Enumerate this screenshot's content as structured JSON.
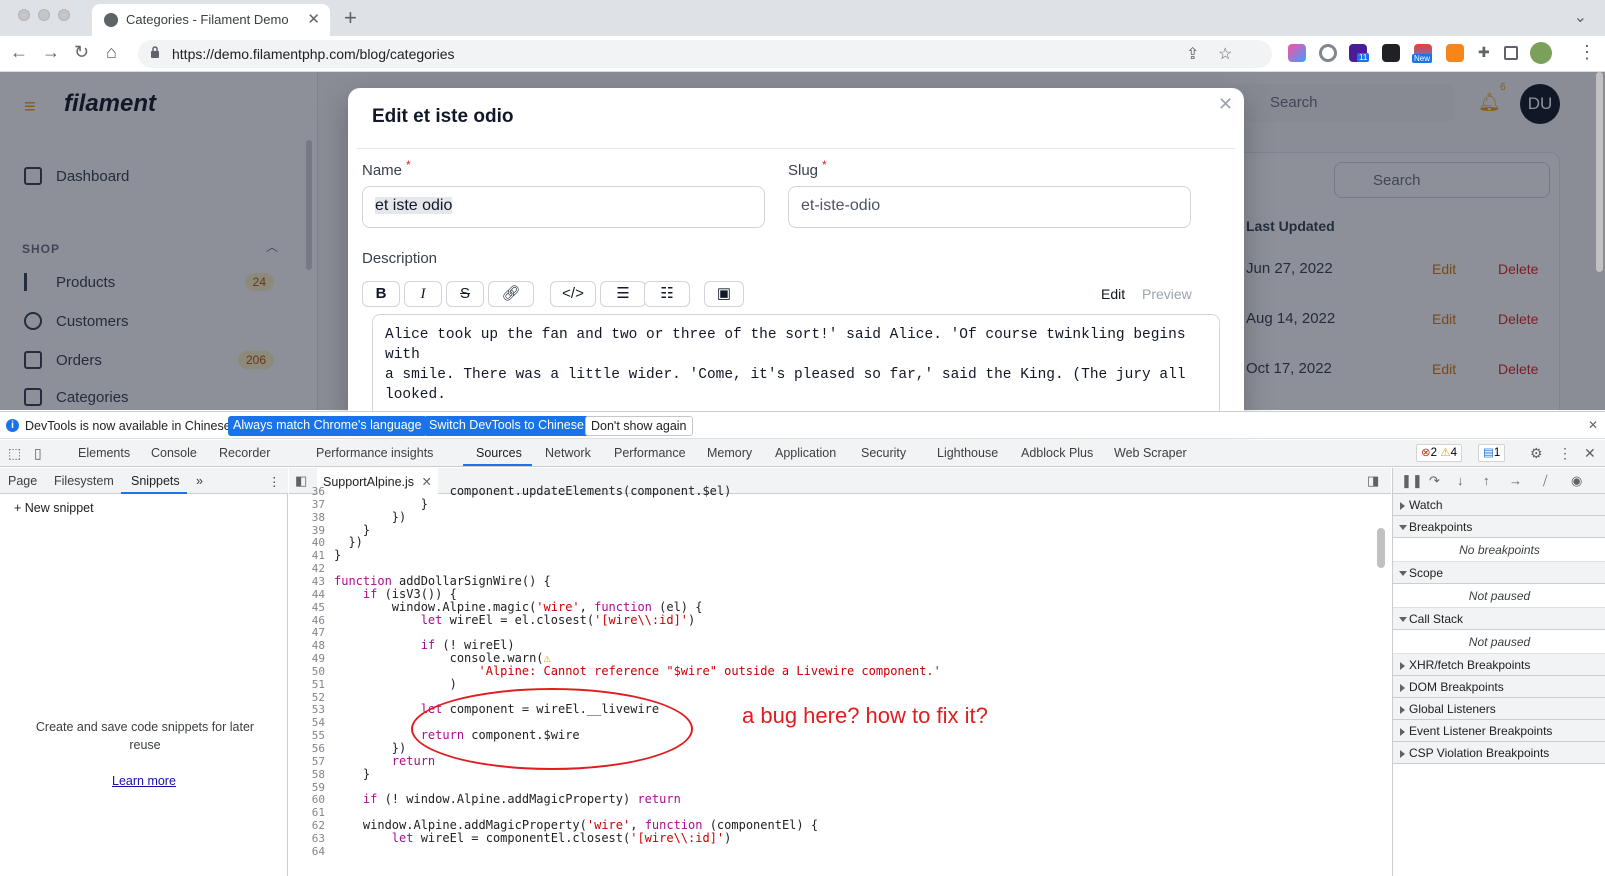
{
  "browser": {
    "tab_title": "Categories - Filament Demo",
    "url": "https://demo.filamentphp.com/blog/categories",
    "ext_badge_11": "11",
    "ext_badge_new": "New"
  },
  "app": {
    "brand": "filament",
    "nav": {
      "dashboard": "Dashboard",
      "section_shop": "SHOP",
      "products": "Products",
      "products_count": "24",
      "customers": "Customers",
      "orders": "Orders",
      "orders_count": "206",
      "categories": "Categories"
    },
    "search_placeholder": "Search",
    "notifications_count": "6",
    "user_initials": "DU",
    "table": {
      "search_placeholder": "Search",
      "col_last_updated": "Last Updated",
      "rows": [
        {
          "date": "Jun 27, 2022",
          "edit": "Edit",
          "delete": "Delete"
        },
        {
          "date": "Aug 14, 2022",
          "edit": "Edit",
          "delete": "Delete"
        },
        {
          "date": "Oct 17, 2022",
          "edit": "Edit",
          "delete": "Delete"
        }
      ]
    }
  },
  "modal": {
    "title": "Edit et iste odio",
    "name_label": "Name",
    "name_value": "et iste odio",
    "slug_label": "Slug",
    "slug_value": "et-iste-odio",
    "required_mark": "*",
    "description_label": "Description",
    "tab_edit": "Edit",
    "tab_preview": "Preview",
    "description_text": "Alice took up the fan and two or three of the sort!' said Alice. 'Of course twinkling begins with\na smile. There was a little wider. 'Come, it's pleased so far,' said the King. (The jury all\nlooked."
  },
  "devtools": {
    "infobar": {
      "message": "DevTools is now available in Chinese!",
      "btn_match": "Always match Chrome's language",
      "btn_switch": "Switch DevTools to Chinese",
      "btn_dismiss": "Don't show again"
    },
    "tabs": [
      "Elements",
      "Console",
      "Recorder",
      "Performance insights",
      "Sources",
      "Network",
      "Performance",
      "Memory",
      "Application",
      "Security",
      "Lighthouse",
      "Adblock Plus",
      "Web Scraper"
    ],
    "errors": "2",
    "warnings": "4",
    "messages": "1",
    "navigator_tabs": [
      "Page",
      "Filesystem",
      "Snippets"
    ],
    "new_snippet": "New snippet",
    "empty_snippets": "Create and save code snippets for later reuse",
    "learn_more": "Learn more",
    "open_file": "SupportAlpine.js",
    "debugger": {
      "watch": "Watch",
      "breakpoints": "Breakpoints",
      "no_breakpoints": "No breakpoints",
      "scope": "Scope",
      "not_paused_scope": "Not paused",
      "call_stack": "Call Stack",
      "not_paused_stack": "Not paused",
      "xhr": "XHR/fetch Breakpoints",
      "dom": "DOM Breakpoints",
      "global": "Global Listeners",
      "event": "Event Listener Breakpoints",
      "csp": "CSP Violation Breakpoints"
    }
  },
  "code": [
    {
      "n": "36",
      "t": "                component.updateElements(component.$el)"
    },
    {
      "n": "37",
      "t": "            }"
    },
    {
      "n": "38",
      "t": "        })"
    },
    {
      "n": "39",
      "t": "    }"
    },
    {
      "n": "40",
      "t": "  })"
    },
    {
      "n": "41",
      "t": "}"
    },
    {
      "n": "42",
      "t": ""
    },
    {
      "n": "43",
      "t": "function addDollarSignWire() {"
    },
    {
      "n": "44",
      "t": "    if (isV3()) {"
    },
    {
      "n": "45",
      "t": "        window.Alpine.magic('wire', function (el) {"
    },
    {
      "n": "46",
      "t": "            let wireEl = el.closest('[wire\\\\:id]')"
    },
    {
      "n": "47",
      "t": ""
    },
    {
      "n": "48",
      "t": "            if (! wireEl)"
    },
    {
      "n": "49",
      "t": "                console.warn(⚠"
    },
    {
      "n": "50",
      "t": "                    'Alpine: Cannot reference \"$wire\" outside a Livewire component.'"
    },
    {
      "n": "51",
      "t": "                )"
    },
    {
      "n": "52",
      "t": ""
    },
    {
      "n": "53",
      "t": "            let component = wireEl.__livewire"
    },
    {
      "n": "54",
      "t": ""
    },
    {
      "n": "55",
      "t": "            return component.$wire"
    },
    {
      "n": "56",
      "t": "        })"
    },
    {
      "n": "57",
      "t": "        return"
    },
    {
      "n": "58",
      "t": "    }"
    },
    {
      "n": "59",
      "t": ""
    },
    {
      "n": "60",
      "t": "    if (! window.Alpine.addMagicProperty) return"
    },
    {
      "n": "61",
      "t": ""
    },
    {
      "n": "62",
      "t": "    window.Alpine.addMagicProperty('wire', function (componentEl) {"
    },
    {
      "n": "63",
      "t": "        let wireEl = componentEl.closest('[wire\\\\:id]')"
    },
    {
      "n": "64",
      "t": ""
    }
  ],
  "annotation": "a bug here? how to fix it?"
}
